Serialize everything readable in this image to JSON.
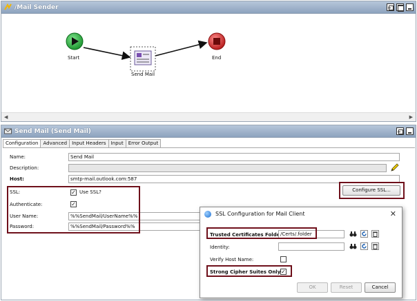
{
  "flow_panel": {
    "title": "/Mail Sender",
    "nodes": {
      "start": "Start",
      "send_mail": "Send Mail",
      "end": "End"
    }
  },
  "mail_panel": {
    "title": "Send Mail (Send Mail)",
    "tabs": [
      "Configuration",
      "Advanced",
      "Input Headers",
      "Input",
      "Error Output"
    ],
    "fields": {
      "name_label": "Name:",
      "name_value": "Send Mail",
      "description_label": "Description:",
      "description_value": "",
      "host_label": "Host:",
      "host_value": "smtp-mail.outlook.com:587",
      "ssl_label": "SSL:",
      "use_ssl_label": "Use SSL?",
      "use_ssl_checked": "✓",
      "authenticate_label": "Authenticate:",
      "authenticate_checked": "✓",
      "username_label": "User Name:",
      "username_value": "%%SendMail/UserName%%",
      "password_label": "Password:",
      "password_value": "%%SendMail/Password%%"
    },
    "configure_ssl_button": "Configure SSL..."
  },
  "ssl_dialog": {
    "title": "SSL Configuration for Mail Client",
    "close_glyph": "✕",
    "trusted_label": "Trusted Certificates Folder:",
    "trusted_value": "/Certs/.folder",
    "identity_label": "Identity:",
    "identity_value": "",
    "verify_host_label": "Verify Host Name:",
    "verify_host_checked": "",
    "strong_cipher_label": "Strong Cipher Suites Only:",
    "strong_cipher_checked": "✓",
    "ok_button": "OK",
    "reset_button": "Reset",
    "cancel_button": "Cancel"
  },
  "colors": {
    "highlight": "#6e0f1a",
    "start_node": "#27b43c",
    "end_node": "#d62a2a",
    "titlebar": "#9fb3cc"
  }
}
